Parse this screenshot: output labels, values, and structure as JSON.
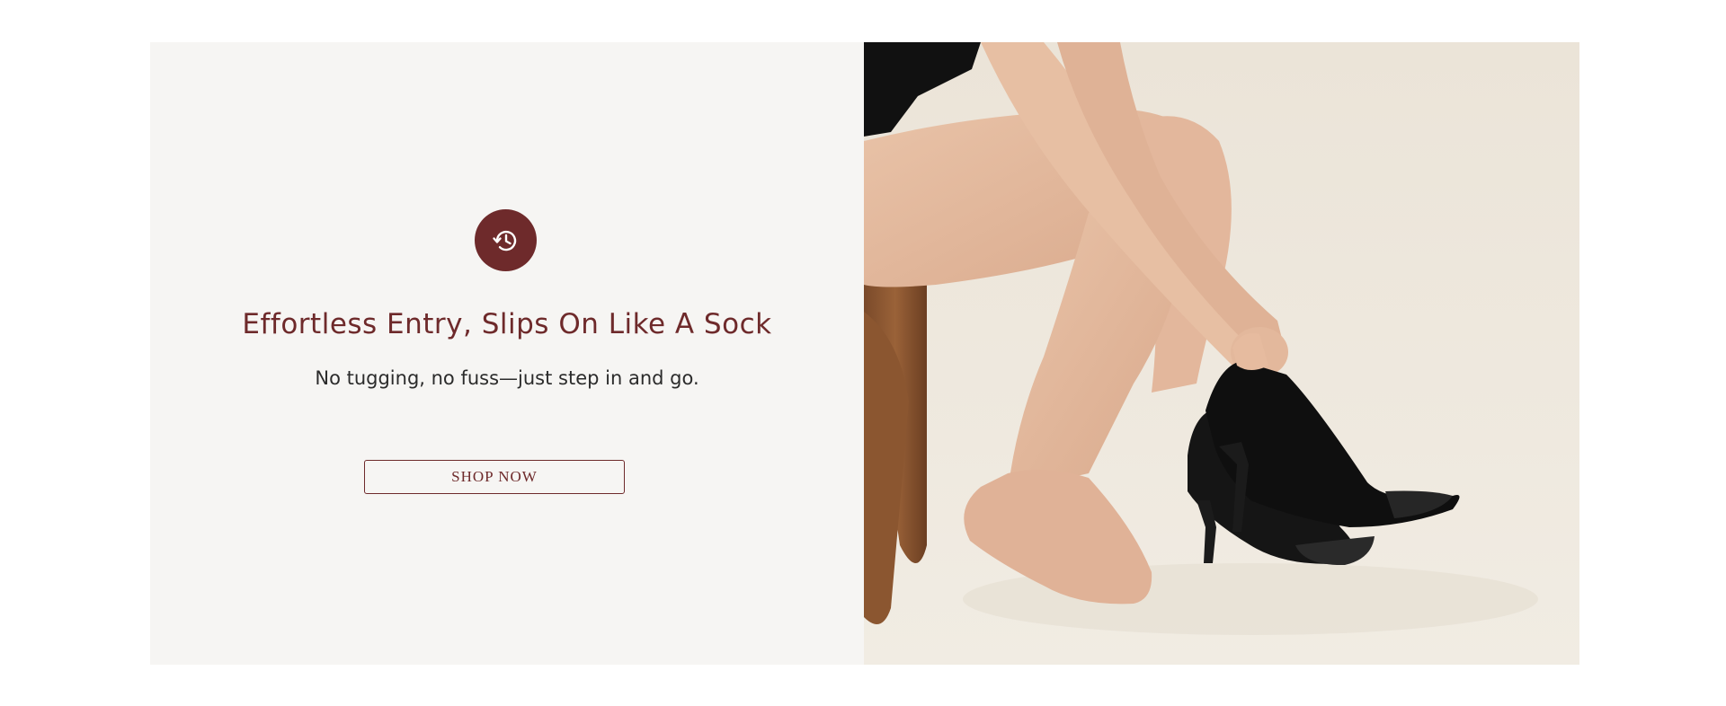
{
  "feature": {
    "icon": "history-icon",
    "headline": "Effortless Entry, Slips On Like A Sock",
    "subline": "No tugging, no fuss—just step in and go.",
    "cta_label": "SHOP NOW"
  },
  "colors": {
    "accent": "#6e2a2b",
    "panel_bg": "#f6f5f3",
    "photo_bg": "#ece6da"
  }
}
